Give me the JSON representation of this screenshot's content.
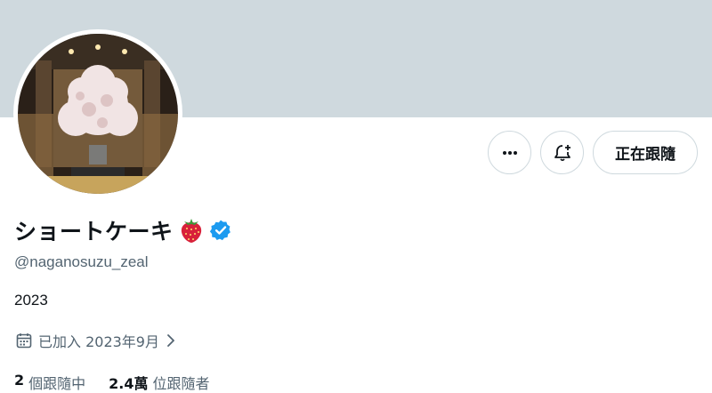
{
  "profile": {
    "display_name": "ショートケーキ",
    "name_emoji": "🍓",
    "handle": "@naganosuzu_zeal",
    "bio": "2023",
    "joined": "已加入 2023年9月",
    "verified_color": "#1d9bf0"
  },
  "actions": {
    "more_icon": "more-icon",
    "notify_icon": "bell-plus-icon",
    "follow_label": "正在跟隨"
  },
  "stats": {
    "following_count": "2",
    "following_label": "個跟隨中",
    "followers_count": "2.4萬",
    "followers_label": "位跟隨者"
  },
  "colors": {
    "banner": "#cfd9de",
    "secondary_text": "#536471",
    "primary_text": "#0f1419"
  }
}
